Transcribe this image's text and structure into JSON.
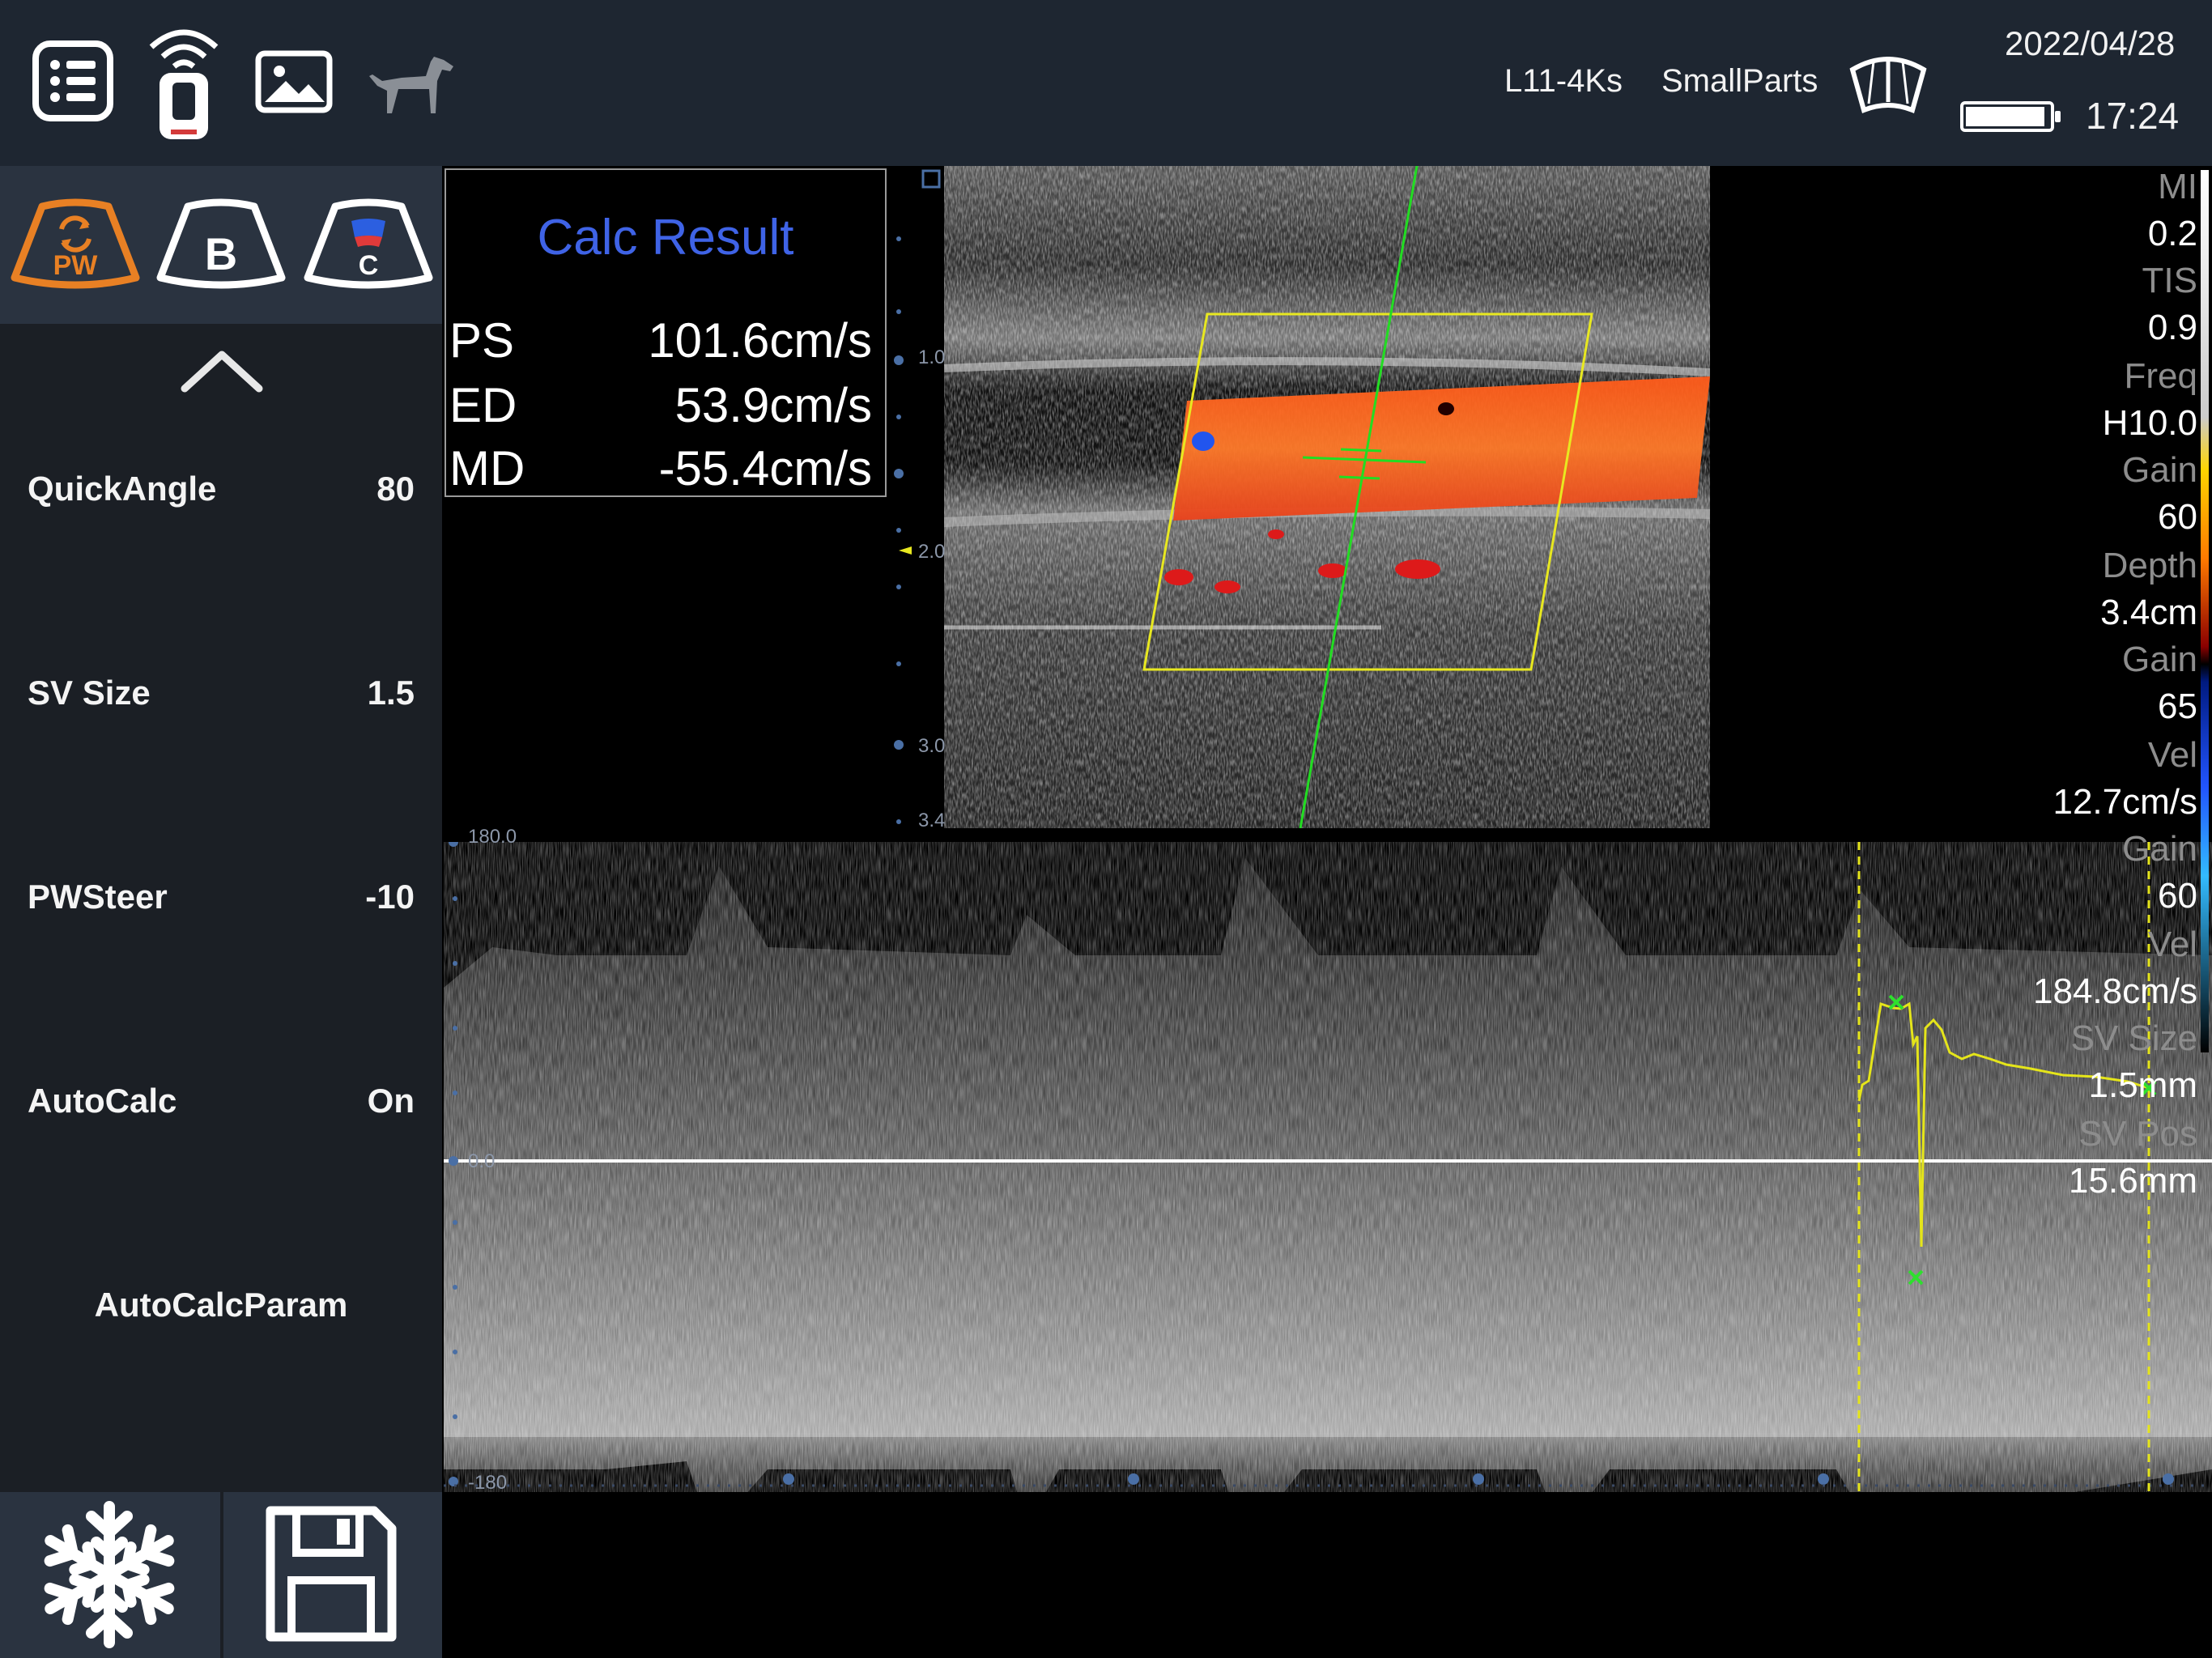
{
  "header": {
    "probe": "L11-4Ks",
    "preset": "SmallParts",
    "date": "2022/04/28",
    "time": "17:24",
    "battery_level": 0.95,
    "icons": [
      "menu-list-icon",
      "probe-icon",
      "gallery-icon",
      "dog-icon",
      "scan-sector-icon",
      "battery-icon"
    ]
  },
  "modes": [
    {
      "label": "PW",
      "active": true
    },
    {
      "label": "B",
      "active": false
    },
    {
      "label": "C",
      "active": false
    }
  ],
  "params": [
    {
      "label": "QuickAngle",
      "value": "80"
    },
    {
      "label": "SV Size",
      "value": "1.5"
    },
    {
      "label": "PWSteer",
      "value": "-10"
    },
    {
      "label": "AutoCalc",
      "value": "On"
    }
  ],
  "autocalc_param_label": "AutoCalcParam",
  "calc": {
    "title": "Calc Result",
    "rows": [
      {
        "name": "PS",
        "value": "101.6cm/s"
      },
      {
        "name": "ED",
        "value": "53.9cm/s"
      },
      {
        "name": "MD",
        "value": "-55.4cm/s"
      }
    ]
  },
  "right_params": [
    {
      "label": "MI",
      "value": "0.2"
    },
    {
      "label": "TIS",
      "value": "0.9"
    },
    {
      "label": "Freq",
      "value": "H10.0"
    },
    {
      "label": "Gain",
      "value": "60"
    },
    {
      "label": "Depth",
      "value": "3.4cm"
    },
    {
      "label": "Gain",
      "value": "65"
    },
    {
      "label": "Vel",
      "value": "12.7cm/s"
    },
    {
      "label": "Gain",
      "value": "60"
    },
    {
      "label": "Vel",
      "value": "184.8cm/s"
    },
    {
      "label": "SV Size",
      "value": "1.5mm"
    },
    {
      "label": "SV Pos",
      "value": "15.6mm"
    }
  ],
  "depth_scale": [
    "1.0",
    "2.0",
    "3.0",
    "3.4"
  ],
  "velocity_scale": {
    "top": "180.0",
    "zero": "0.0",
    "bottom": "-180"
  },
  "colors": {
    "accent_active": "#e88024",
    "calc_title": "#3f63e6",
    "topbar": "#1e2631",
    "panel": "#1b1f25",
    "trace": "#e5e51a",
    "marker": "#2ee02e"
  }
}
